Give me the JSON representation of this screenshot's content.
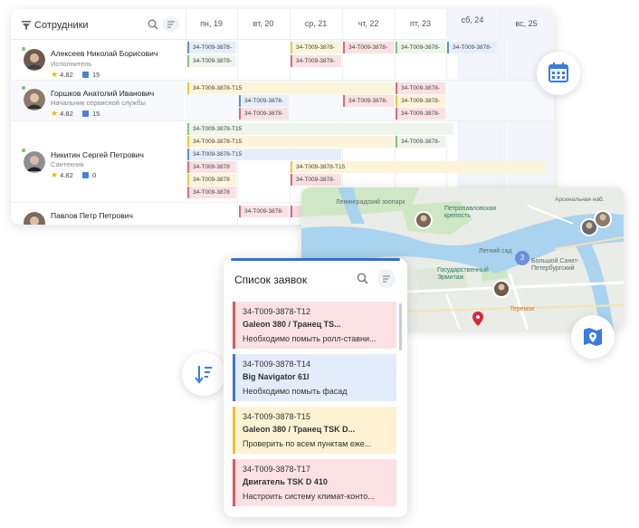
{
  "schedule": {
    "employees_title": "Сотрудники",
    "days": [
      "пн, 19",
      "вт, 20",
      "ср, 21",
      "чт, 22",
      "пт, 23",
      "сб, 24",
      "вс, 25"
    ],
    "employees": [
      {
        "name": "Алексеев Николай Борисович",
        "role": "Исполнитель",
        "rating": "4.82",
        "orders": "15"
      },
      {
        "name": "Горшков Анатолий Иванович",
        "role": "Начальник сервисной службы",
        "rating": "4.82",
        "orders": "15"
      },
      {
        "name": "Никитин Сергей Петрович",
        "role": "Сантехник",
        "rating": "4.82",
        "orders": "0"
      },
      {
        "name": "Павлов Петр Петрович"
      }
    ],
    "task_codes": {
      "short": "34-T009-3878-",
      "mid": "34-T009-3878",
      "full": "34-T009-3878-T15"
    }
  },
  "map": {
    "labels": {
      "zoo": "Ленинградский зоопарк",
      "fortress": "Петропавловская крепость",
      "garden": "Летний сад",
      "hermitage": "Государственный Эрмитаж",
      "theatre": "Большой Санкт-Петербургский",
      "teremok": "Теремок",
      "embankment": "Арсенальная наб.",
      "cluster": "3"
    }
  },
  "requests": {
    "title": "Список заявок",
    "items": [
      {
        "code": "34-T009-3878-T12",
        "title": "Galeon 380 / Транец TS...",
        "desc": "Необходимо помыть ролл-ставни..."
      },
      {
        "code": "34-T009-3878-T14",
        "title": "Big Navigator 61l",
        "desc": "Необходимо помыть фасад"
      },
      {
        "code": "34-T009-3878-T15",
        "title": "Galeon 380 / Транец TSK D...",
        "desc": "Проверить по всем пунктам еже..."
      },
      {
        "code": "34-T009-3878-T17",
        "title": "Двигатель TSK D 410",
        "desc": "Настроить систему климат-конто..."
      }
    ]
  },
  "colors": {
    "accent": "#2f6fd6",
    "red": "#e05562",
    "yellow": "#f1bf31",
    "green": "#8bc27a"
  },
  "icons": [
    "filter-icon",
    "search-icon",
    "sort-icon",
    "calendar-icon",
    "map-icon",
    "sort-down-icon",
    "star-icon",
    "document-icon"
  ]
}
